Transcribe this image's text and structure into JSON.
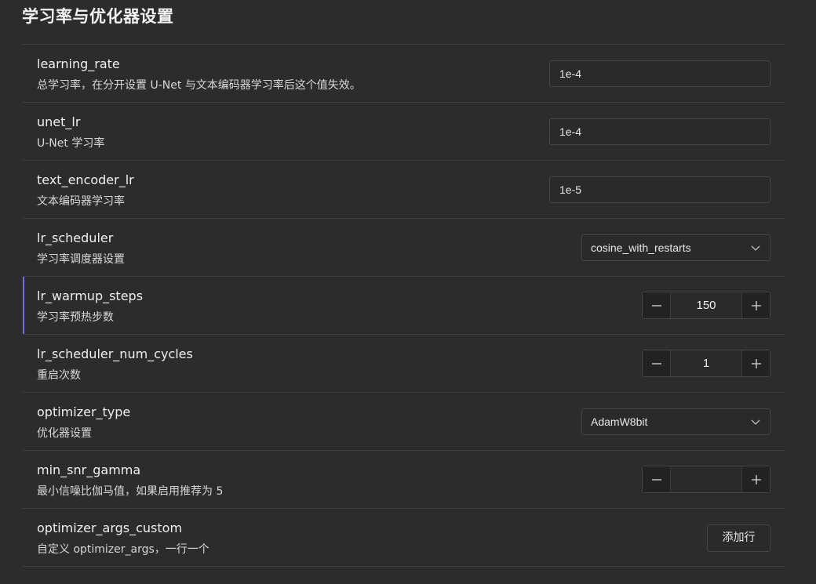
{
  "section": {
    "title": "学习率与优化器设置"
  },
  "rows": [
    {
      "name": "learning_rate",
      "desc": "总学习率，在分开设置 U-Net 与文本编码器学习率后这个值失效。",
      "control": "input",
      "value": "1e-4"
    },
    {
      "name": "unet_lr",
      "desc": "U-Net 学习率",
      "control": "input",
      "value": "1e-4"
    },
    {
      "name": "text_encoder_lr",
      "desc": "文本编码器学习率",
      "control": "input",
      "value": "1e-5"
    },
    {
      "name": "lr_scheduler",
      "desc": "学习率调度器设置",
      "control": "select",
      "value": "cosine_with_restarts"
    },
    {
      "name": "lr_warmup_steps",
      "desc": "学习率预热步数",
      "control": "stepper",
      "value": "150"
    },
    {
      "name": "lr_scheduler_num_cycles",
      "desc": "重启次数",
      "control": "stepper",
      "value": "1"
    },
    {
      "name": "optimizer_type",
      "desc": "优化器设置",
      "control": "select",
      "value": "AdamW8bit"
    },
    {
      "name": "min_snr_gamma",
      "desc": "最小信噪比伽马值，如果启用推荐为 5",
      "control": "stepper",
      "value": ""
    },
    {
      "name": "optimizer_args_custom",
      "desc": "自定义 optimizer_args，一行一个",
      "control": "button",
      "value": "添加行"
    }
  ],
  "colors": {
    "background": "#2c2c2c",
    "border": "#3e3e3e",
    "accent": "#6f74d8"
  },
  "icons": {
    "select": "chevron-down-icon",
    "stepper_minus": "minus-icon",
    "stepper_plus": "plus-icon"
  }
}
